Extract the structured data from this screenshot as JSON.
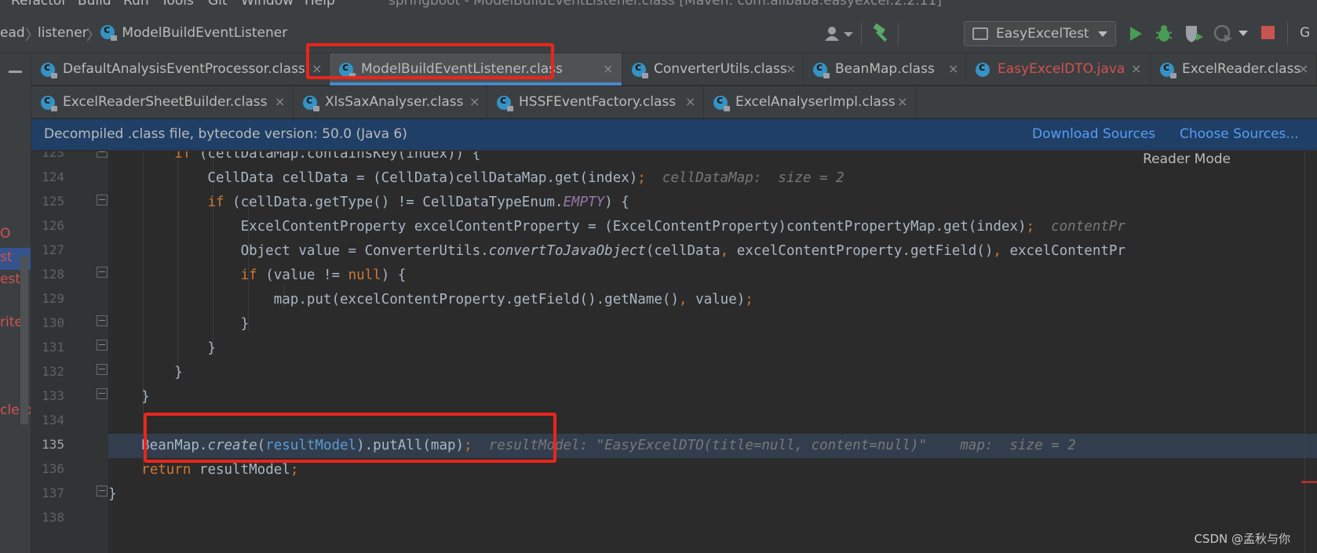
{
  "menubar": {
    "items": [
      "Refactor",
      "Build",
      "Run",
      "Tools",
      "Git",
      "Window",
      "Help"
    ],
    "title": "springboot - ModelBuildEventListener.class [Maven: com.alibaba:easyexcel:2.2.11]"
  },
  "navbar": {
    "crumbs": [
      "ead",
      "listener",
      "ModelBuildEventListener"
    ],
    "run_config": "EasyExcelTest",
    "extra": "G"
  },
  "tabs_row1": [
    {
      "label": "DefaultAnalysisEventProcessor.class",
      "close": "×"
    },
    {
      "label": "ModelBuildEventListener.class",
      "close": "×"
    },
    {
      "label": "ConverterUtils.class",
      "close": "×"
    },
    {
      "label": "BeanMap.class",
      "close": "×"
    },
    {
      "label": "EasyExcelDTO.java",
      "close": "×"
    },
    {
      "label": "ExcelReader.class",
      "close": "×"
    }
  ],
  "tabs_row2": [
    {
      "label": "ExcelReaderSheetBuilder.class",
      "close": "×"
    },
    {
      "label": "XlsSaxAnalyser.class",
      "close": "×"
    },
    {
      "label": "HSSFEventFactory.class",
      "close": "×"
    },
    {
      "label": "ExcelAnalyserImpl.class",
      "close": "×"
    }
  ],
  "banner": {
    "message": "Decompiled .class file, bytecode version: 50.0 (Java 6)",
    "download_sources": "Download Sources",
    "choose_sources": "Choose Sources..."
  },
  "editor": {
    "reader_mode": "Reader Mode",
    "line_numbers": [
      "123",
      "124",
      "125",
      "126",
      "127",
      "128",
      "129",
      "130",
      "131",
      "132",
      "133",
      "134",
      "135",
      "136",
      "137",
      "138"
    ],
    "left_strip_text": [
      "O",
      "st",
      "est",
      "riter",
      "cleEx"
    ]
  },
  "watermark": "CSDN @孟秋与你",
  "colors": {
    "annotation": "#e8261c",
    "active_tab_underline": "#4a88c7",
    "banner_bg": "#1f3f66",
    "link": "#589df6",
    "keyword": "#cc7832"
  }
}
